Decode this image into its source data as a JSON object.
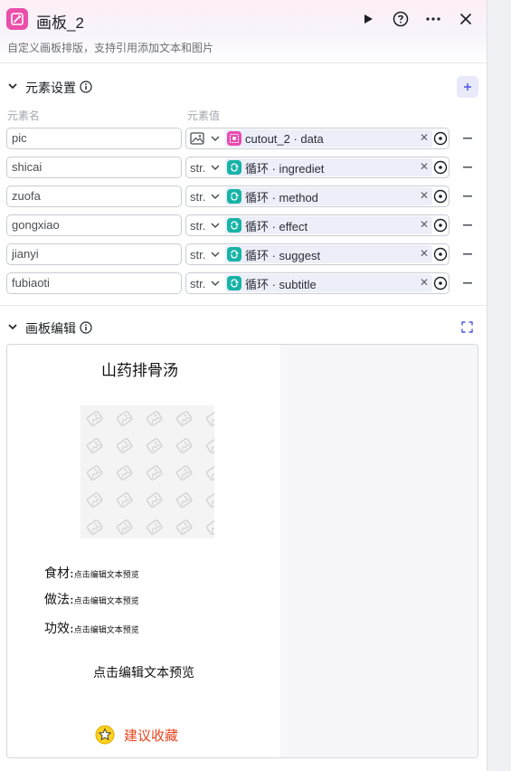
{
  "header": {
    "title": "画板_2",
    "subtitle": "自定义画板排版，支持引用添加文本和图片",
    "accent": "#ea4fa9"
  },
  "elements_section": {
    "title": "元素设置",
    "col_name": "元素名",
    "col_value": "元素值",
    "rows": [
      {
        "name": "pic",
        "type": "",
        "type_icon": "image-icon",
        "tag_icon": "cutout-icon",
        "tag_color": "#e84bb0",
        "value": "cutout_2 · data"
      },
      {
        "name": "shicai",
        "type": "str.",
        "tag_icon": "loop-icon",
        "tag_color": "#17b3a7",
        "value": "循环 · ingrediet"
      },
      {
        "name": "zuofa",
        "type": "str.",
        "tag_icon": "loop-icon",
        "tag_color": "#17b3a7",
        "value": "循环 · method"
      },
      {
        "name": "gongxiao",
        "type": "str.",
        "tag_icon": "loop-icon",
        "tag_color": "#17b3a7",
        "value": "循环 · effect"
      },
      {
        "name": "jianyi",
        "type": "str.",
        "tag_icon": "loop-icon",
        "tag_color": "#17b3a7",
        "value": "循环 · suggest"
      },
      {
        "name": "fubiaoti",
        "type": "str.",
        "tag_icon": "loop-icon",
        "tag_color": "#17b3a7",
        "value": "循环 · subtitle"
      }
    ]
  },
  "canvas_section": {
    "title": "画板编辑"
  },
  "canvas": {
    "title": "山药排骨汤",
    "lines": [
      {
        "label": "食材:",
        "value": "点击编辑文本预览"
      },
      {
        "label": "做法:",
        "value": "点击编辑文本预览"
      },
      {
        "label": "功效:",
        "value": "点击编辑文本预览"
      }
    ],
    "preview": "点击编辑文本预览",
    "favorite": "建议收藏"
  }
}
